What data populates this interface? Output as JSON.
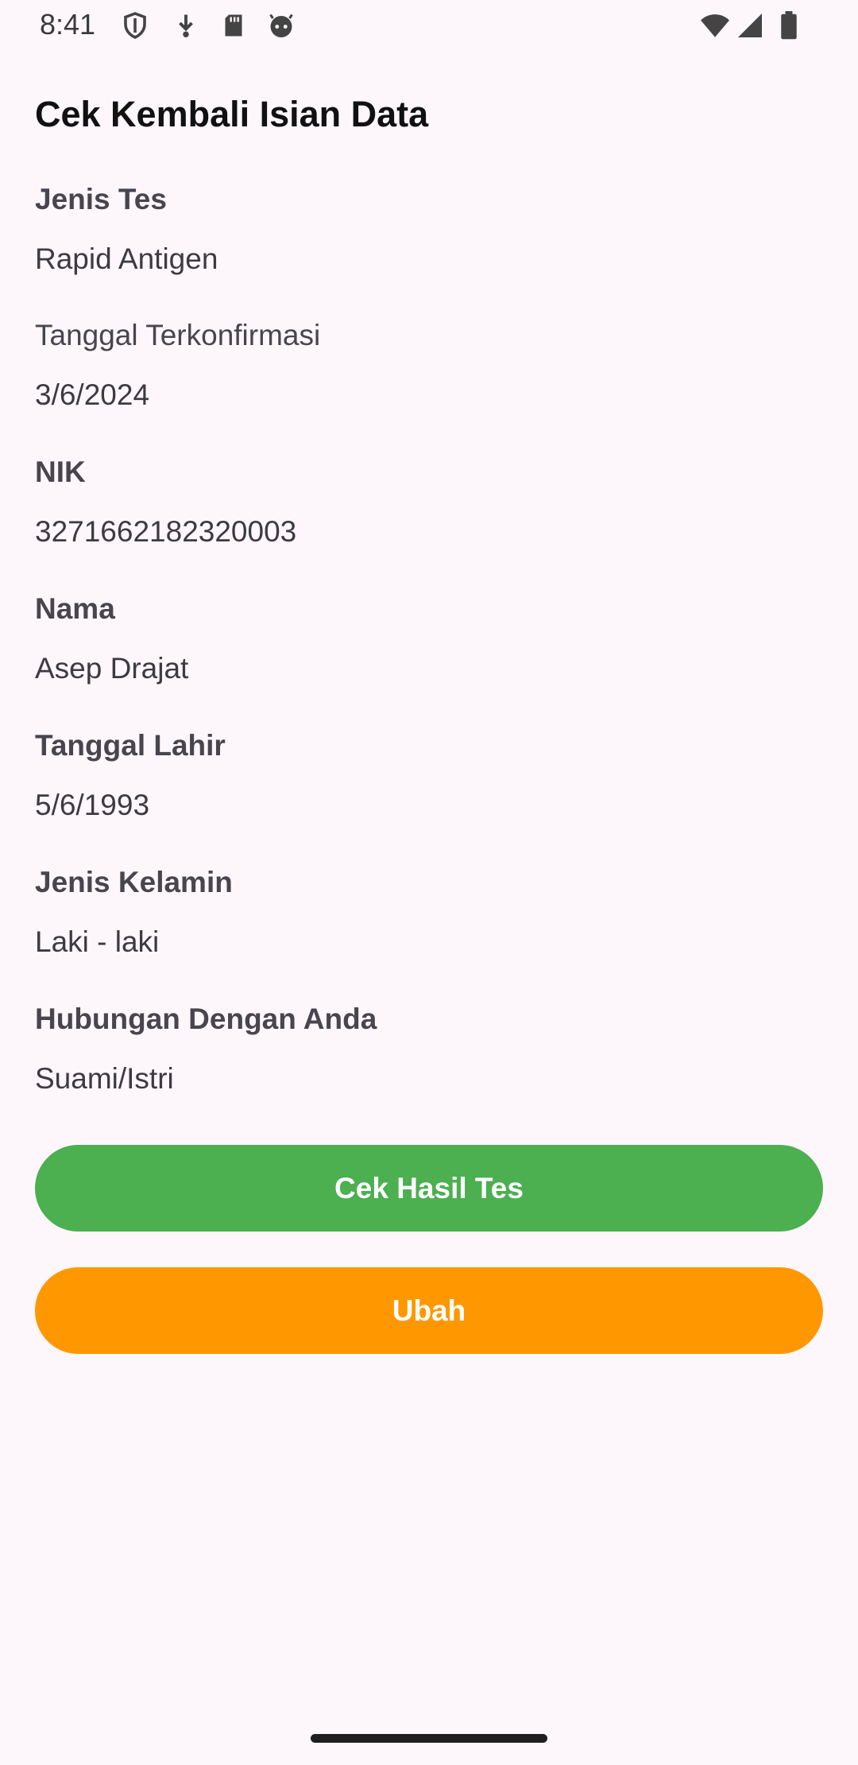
{
  "status_bar": {
    "time": "8:41",
    "icons": [
      "shield-icon",
      "download-icon",
      "sd-card-icon",
      "android-face-icon",
      "wifi-icon",
      "cell-signal-icon",
      "battery-icon"
    ]
  },
  "page": {
    "title": "Cek Kembali Isian Data"
  },
  "fields": [
    {
      "label": "Jenis Tes",
      "value": "Rapid Antigen"
    },
    {
      "label": "Tanggal Terkonfirmasi",
      "value": "3/6/2024"
    },
    {
      "label": "NIK",
      "value": "3271662182320003"
    },
    {
      "label": "Nama",
      "value": "Asep Drajat"
    },
    {
      "label": "Tanggal Lahir",
      "value": "5/6/1993"
    },
    {
      "label": "Jenis Kelamin",
      "value": "Laki - laki"
    },
    {
      "label": "Hubungan Dengan Anda",
      "value": "Suami/Istri"
    }
  ],
  "buttons": {
    "check_results": "Cek Hasil Tes",
    "edit": "Ubah"
  },
  "colors": {
    "background": "#fdf7fc",
    "check_button": "#4caf50",
    "edit_button": "#ff9800"
  }
}
